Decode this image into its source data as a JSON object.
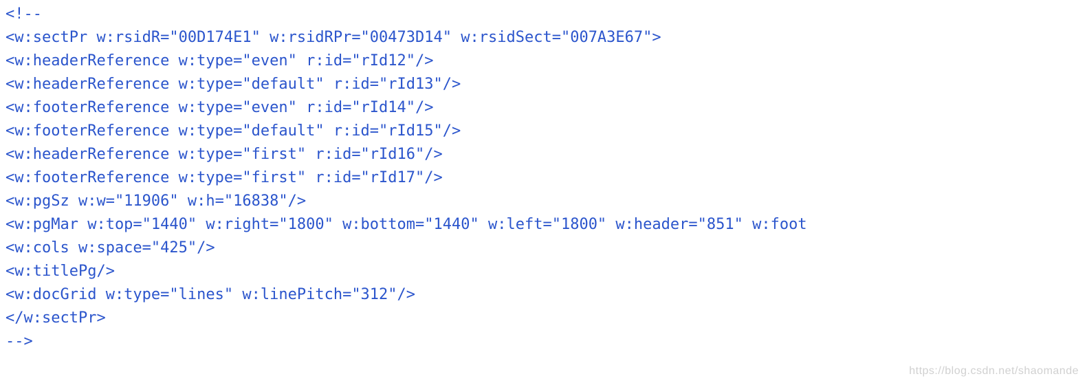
{
  "code_lines": [
    "<!--",
    "<w:sectPr w:rsidR=\"00D174E1\" w:rsidRPr=\"00473D14\" w:rsidSect=\"007A3E67\">",
    "<w:headerReference w:type=\"even\" r:id=\"rId12\"/>",
    "<w:headerReference w:type=\"default\" r:id=\"rId13\"/>",
    "<w:footerReference w:type=\"even\" r:id=\"rId14\"/>",
    "<w:footerReference w:type=\"default\" r:id=\"rId15\"/>",
    "<w:headerReference w:type=\"first\" r:id=\"rId16\"/>",
    "<w:footerReference w:type=\"first\" r:id=\"rId17\"/>",
    "<w:pgSz w:w=\"11906\" w:h=\"16838\"/>",
    "<w:pgMar w:top=\"1440\" w:right=\"1800\" w:bottom=\"1440\" w:left=\"1800\" w:header=\"851\" w:foot",
    "<w:cols w:space=\"425\"/>",
    "<w:titlePg/>",
    "<w:docGrid w:type=\"lines\" w:linePitch=\"312\"/>",
    "</w:sectPr>",
    "-->"
  ],
  "watermark": "https://blog.csdn.net/shaomande"
}
